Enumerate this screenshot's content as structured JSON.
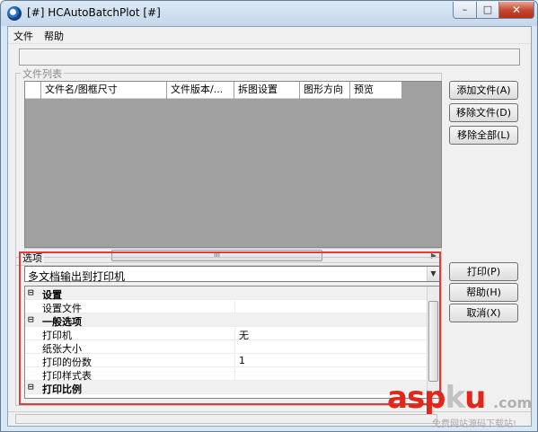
{
  "window": {
    "title": "[#] HCAutoBatchPlot [#]",
    "controls": {
      "minimize": "–",
      "maximize": "□",
      "close": "✕"
    }
  },
  "menu": {
    "items": [
      "文件",
      "帮助"
    ]
  },
  "file_list": {
    "group_label": "文件列表",
    "columns": [
      "文件名/图框尺寸",
      "文件版本/...",
      "拆图设置",
      "图形方向",
      "预览"
    ],
    "scroll_thumb": "III",
    "buttons": {
      "add": "添加文件(A)",
      "remove": "移除文件(D)",
      "remove_all": "移除全部(L)"
    }
  },
  "options": {
    "group_label": "选项",
    "mode_selected": "多文档输出到打印机",
    "properties": [
      {
        "type": "category",
        "toggle": "⊟",
        "name": "设置"
      },
      {
        "type": "item",
        "name": "设置文件",
        "value": ""
      },
      {
        "type": "category",
        "toggle": "⊟",
        "name": "一般选项"
      },
      {
        "type": "item",
        "name": "打印机",
        "value": "无"
      },
      {
        "type": "item",
        "name": "纸张大小",
        "value": ""
      },
      {
        "type": "item",
        "name": "打印的份数",
        "value": "1"
      },
      {
        "type": "item",
        "name": "打印样式表",
        "value": ""
      },
      {
        "type": "category",
        "toggle": "⊟",
        "name": "打印比例"
      }
    ],
    "buttons": {
      "print": "打印(P)",
      "help": "帮助(H)",
      "cancel": "取消(X)"
    }
  },
  "watermark": {
    "brand": "asp",
    "brand_k": "k",
    "brand_u": "u",
    "tld": ".com",
    "subtitle": "免费网站源码下载站!"
  },
  "colors": {
    "highlight": "#e23a3a",
    "list_bg": "#a0a0a0",
    "close_button": "#c4432b"
  }
}
